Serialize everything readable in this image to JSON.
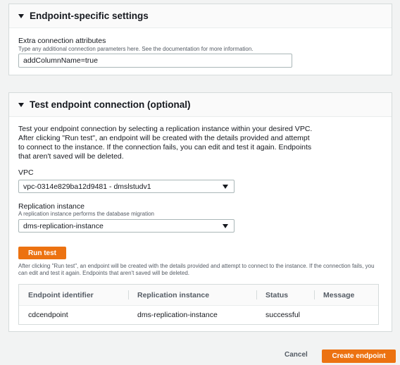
{
  "endpoint_settings": {
    "title": "Endpoint-specific settings",
    "extra_attrs_label": "Extra connection attributes",
    "extra_attrs_hint": "Type any additional connection parameters here. See the documentation for more information.",
    "extra_attrs_value": "addColumnName=true"
  },
  "test_connection": {
    "title": "Test endpoint connection (optional)",
    "description": "Test your endpoint connection by selecting a replication instance within your desired VPC. After clicking \"Run test\", an endpoint will be created with the details provided and attempt to connect to the instance. If the connection fails, you can edit and test it again. Endpoints that aren't saved will be deleted.",
    "vpc_label": "VPC",
    "vpc_value": "vpc-0314e829ba12d9481 - dmslstudv1",
    "ri_label": "Replication instance",
    "ri_hint": "A replication instance performs the database migration",
    "ri_value": "dms-replication-instance",
    "run_test_label": "Run test",
    "run_note": "After clicking \"Run test\", an endpoint will be created with the details provided and attempt to connect to the instance. If the connection fails, you can edit and test it again. Endpoints that aren't saved will be deleted.",
    "table": {
      "headers": [
        "Endpoint identifier",
        "Replication instance",
        "Status",
        "Message"
      ],
      "rows": [
        [
          "cdcendpoint",
          "dms-replication-instance",
          "successful",
          ""
        ]
      ]
    }
  },
  "footer": {
    "cancel_label": "Cancel",
    "create_label": "Create endpoint"
  },
  "colors": {
    "accent": "#ec7211",
    "background": "#f2f3f3",
    "panel_header": "#fafafa"
  }
}
